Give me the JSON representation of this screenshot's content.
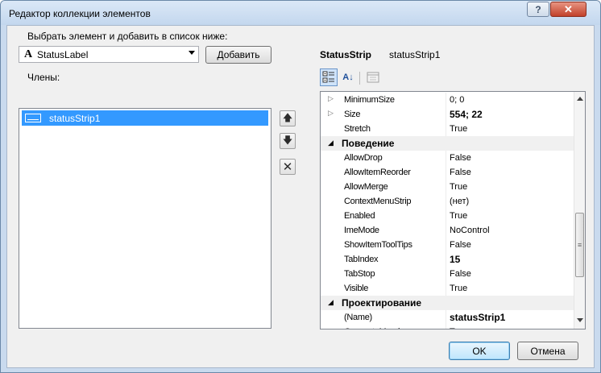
{
  "window": {
    "title": "Редактор коллекции элементов",
    "help_label": "?",
    "close_label": "✕"
  },
  "left": {
    "add_prompt": "Выбрать элемент и добавить в список ниже:",
    "combo_icon_label": "A",
    "combo_value": "StatusLabel",
    "add_button": "Добавить",
    "members_label": "Члены:",
    "members": [
      "statusStrip1"
    ]
  },
  "side_buttons": {
    "up": "🡅",
    "down": "🡇",
    "delete": "✕"
  },
  "right": {
    "type_name": "StatusStrip",
    "object_name": "statusStrip1",
    "toolbar": [
      "categorized-icon",
      "alphabetical-icon",
      "property-pages-icon"
    ],
    "toolbar_alpha_label": "A↓",
    "rows": [
      {
        "kind": "prop",
        "expander": "▷",
        "name": "MinimumSize",
        "value": "0; 0",
        "bold": false
      },
      {
        "kind": "prop",
        "expander": "▷",
        "name": "Size",
        "value": "554; 22",
        "bold": true
      },
      {
        "kind": "prop",
        "expander": "",
        "name": "Stretch",
        "value": "True",
        "bold": false
      },
      {
        "kind": "cat",
        "expander": "◢",
        "name": "Поведение"
      },
      {
        "kind": "prop",
        "expander": "",
        "name": "AllowDrop",
        "value": "False",
        "bold": false
      },
      {
        "kind": "prop",
        "expander": "",
        "name": "AllowItemReorder",
        "value": "False",
        "bold": false
      },
      {
        "kind": "prop",
        "expander": "",
        "name": "AllowMerge",
        "value": "True",
        "bold": false
      },
      {
        "kind": "prop",
        "expander": "",
        "name": "ContextMenuStrip",
        "value": "(нет)",
        "bold": false
      },
      {
        "kind": "prop",
        "expander": "",
        "name": "Enabled",
        "value": "True",
        "bold": false
      },
      {
        "kind": "prop",
        "expander": "",
        "name": "ImeMode",
        "value": "NoControl",
        "bold": false
      },
      {
        "kind": "prop",
        "expander": "",
        "name": "ShowItemToolTips",
        "value": "False",
        "bold": false
      },
      {
        "kind": "prop",
        "expander": "",
        "name": "TabIndex",
        "value": "15",
        "bold": true
      },
      {
        "kind": "prop",
        "expander": "",
        "name": "TabStop",
        "value": "False",
        "bold": false
      },
      {
        "kind": "prop",
        "expander": "",
        "name": "Visible",
        "value": "True",
        "bold": false
      },
      {
        "kind": "cat",
        "expander": "◢",
        "name": "Проектирование"
      },
      {
        "kind": "prop",
        "expander": "",
        "name": "(Name)",
        "value": "statusStrip1",
        "bold": true
      },
      {
        "kind": "prop",
        "expander": "",
        "name": "GenerateMember",
        "value": "True",
        "bold": false
      }
    ],
    "scrollbar_grip": "≡"
  },
  "footer": {
    "ok": "OK",
    "cancel": "Отмена"
  }
}
